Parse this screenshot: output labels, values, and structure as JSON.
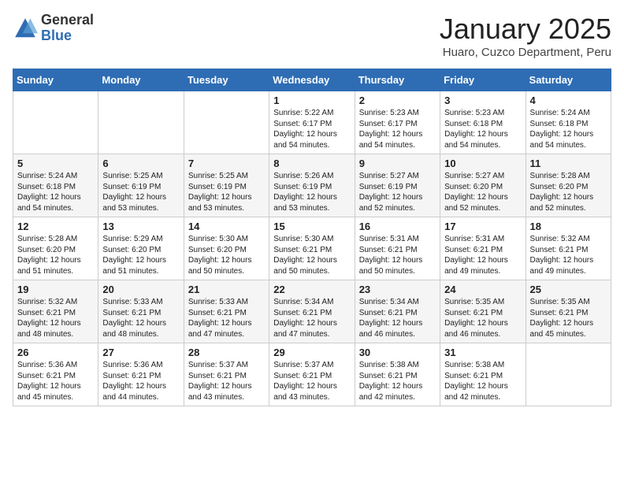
{
  "logo": {
    "general": "General",
    "blue": "Blue"
  },
  "title": "January 2025",
  "subtitle": "Huaro, Cuzco Department, Peru",
  "days_of_week": [
    "Sunday",
    "Monday",
    "Tuesday",
    "Wednesday",
    "Thursday",
    "Friday",
    "Saturday"
  ],
  "weeks": [
    [
      {
        "day": "",
        "info": ""
      },
      {
        "day": "",
        "info": ""
      },
      {
        "day": "",
        "info": ""
      },
      {
        "day": "1",
        "info": "Sunrise: 5:22 AM\nSunset: 6:17 PM\nDaylight: 12 hours\nand 54 minutes."
      },
      {
        "day": "2",
        "info": "Sunrise: 5:23 AM\nSunset: 6:17 PM\nDaylight: 12 hours\nand 54 minutes."
      },
      {
        "day": "3",
        "info": "Sunrise: 5:23 AM\nSunset: 6:18 PM\nDaylight: 12 hours\nand 54 minutes."
      },
      {
        "day": "4",
        "info": "Sunrise: 5:24 AM\nSunset: 6:18 PM\nDaylight: 12 hours\nand 54 minutes."
      }
    ],
    [
      {
        "day": "5",
        "info": "Sunrise: 5:24 AM\nSunset: 6:18 PM\nDaylight: 12 hours\nand 54 minutes."
      },
      {
        "day": "6",
        "info": "Sunrise: 5:25 AM\nSunset: 6:19 PM\nDaylight: 12 hours\nand 53 minutes."
      },
      {
        "day": "7",
        "info": "Sunrise: 5:25 AM\nSunset: 6:19 PM\nDaylight: 12 hours\nand 53 minutes."
      },
      {
        "day": "8",
        "info": "Sunrise: 5:26 AM\nSunset: 6:19 PM\nDaylight: 12 hours\nand 53 minutes."
      },
      {
        "day": "9",
        "info": "Sunrise: 5:27 AM\nSunset: 6:19 PM\nDaylight: 12 hours\nand 52 minutes."
      },
      {
        "day": "10",
        "info": "Sunrise: 5:27 AM\nSunset: 6:20 PM\nDaylight: 12 hours\nand 52 minutes."
      },
      {
        "day": "11",
        "info": "Sunrise: 5:28 AM\nSunset: 6:20 PM\nDaylight: 12 hours\nand 52 minutes."
      }
    ],
    [
      {
        "day": "12",
        "info": "Sunrise: 5:28 AM\nSunset: 6:20 PM\nDaylight: 12 hours\nand 51 minutes."
      },
      {
        "day": "13",
        "info": "Sunrise: 5:29 AM\nSunset: 6:20 PM\nDaylight: 12 hours\nand 51 minutes."
      },
      {
        "day": "14",
        "info": "Sunrise: 5:30 AM\nSunset: 6:20 PM\nDaylight: 12 hours\nand 50 minutes."
      },
      {
        "day": "15",
        "info": "Sunrise: 5:30 AM\nSunset: 6:21 PM\nDaylight: 12 hours\nand 50 minutes."
      },
      {
        "day": "16",
        "info": "Sunrise: 5:31 AM\nSunset: 6:21 PM\nDaylight: 12 hours\nand 50 minutes."
      },
      {
        "day": "17",
        "info": "Sunrise: 5:31 AM\nSunset: 6:21 PM\nDaylight: 12 hours\nand 49 minutes."
      },
      {
        "day": "18",
        "info": "Sunrise: 5:32 AM\nSunset: 6:21 PM\nDaylight: 12 hours\nand 49 minutes."
      }
    ],
    [
      {
        "day": "19",
        "info": "Sunrise: 5:32 AM\nSunset: 6:21 PM\nDaylight: 12 hours\nand 48 minutes."
      },
      {
        "day": "20",
        "info": "Sunrise: 5:33 AM\nSunset: 6:21 PM\nDaylight: 12 hours\nand 48 minutes."
      },
      {
        "day": "21",
        "info": "Sunrise: 5:33 AM\nSunset: 6:21 PM\nDaylight: 12 hours\nand 47 minutes."
      },
      {
        "day": "22",
        "info": "Sunrise: 5:34 AM\nSunset: 6:21 PM\nDaylight: 12 hours\nand 47 minutes."
      },
      {
        "day": "23",
        "info": "Sunrise: 5:34 AM\nSunset: 6:21 PM\nDaylight: 12 hours\nand 46 minutes."
      },
      {
        "day": "24",
        "info": "Sunrise: 5:35 AM\nSunset: 6:21 PM\nDaylight: 12 hours\nand 46 minutes."
      },
      {
        "day": "25",
        "info": "Sunrise: 5:35 AM\nSunset: 6:21 PM\nDaylight: 12 hours\nand 45 minutes."
      }
    ],
    [
      {
        "day": "26",
        "info": "Sunrise: 5:36 AM\nSunset: 6:21 PM\nDaylight: 12 hours\nand 45 minutes."
      },
      {
        "day": "27",
        "info": "Sunrise: 5:36 AM\nSunset: 6:21 PM\nDaylight: 12 hours\nand 44 minutes."
      },
      {
        "day": "28",
        "info": "Sunrise: 5:37 AM\nSunset: 6:21 PM\nDaylight: 12 hours\nand 43 minutes."
      },
      {
        "day": "29",
        "info": "Sunrise: 5:37 AM\nSunset: 6:21 PM\nDaylight: 12 hours\nand 43 minutes."
      },
      {
        "day": "30",
        "info": "Sunrise: 5:38 AM\nSunset: 6:21 PM\nDaylight: 12 hours\nand 42 minutes."
      },
      {
        "day": "31",
        "info": "Sunrise: 5:38 AM\nSunset: 6:21 PM\nDaylight: 12 hours\nand 42 minutes."
      },
      {
        "day": "",
        "info": ""
      }
    ]
  ]
}
